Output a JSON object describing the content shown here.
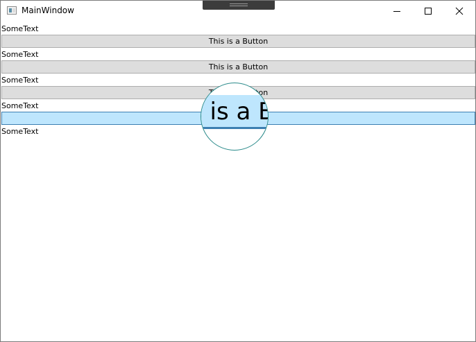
{
  "window": {
    "title": "MainWindow",
    "icon": "app-window-icon"
  },
  "titlebar_controls": {
    "minimize_icon": "minimize-icon",
    "maximize_icon": "maximize-icon",
    "close_icon": "close-icon"
  },
  "content": {
    "items": [
      {
        "label": "SomeText",
        "button": "This is a Button"
      },
      {
        "label": "SomeText",
        "button": "This is a Button"
      },
      {
        "label": "SomeText",
        "button": "This is a Button"
      },
      {
        "label": "SomeText",
        "button": "This is a Button"
      },
      {
        "label": "SomeText"
      }
    ]
  },
  "magnifier": {
    "text": "s is a B"
  },
  "colors": {
    "button_face": "#dddddd",
    "button_hover": "#bee6fd",
    "button_hover_border": "#3c7fb1",
    "magnifier_ring": "#2a8a8a"
  }
}
